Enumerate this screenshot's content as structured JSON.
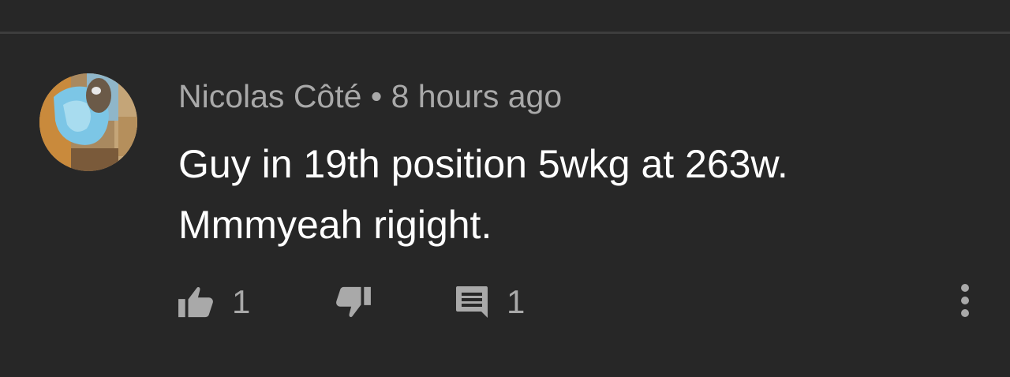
{
  "comment": {
    "author": "Nicolas Côté",
    "separator": "•",
    "timestamp": "8 hours ago",
    "lines": [
      "Guy in 19th position 5wkg at 263w.",
      "Mmmyeah rigight."
    ],
    "likes": "1",
    "replies": "1"
  },
  "colors": {
    "background": "#272727",
    "meta_text": "#a9a9a9",
    "body_text": "#ffffff",
    "icon": "#a9a9a9"
  },
  "icons": {
    "like": "thumbs-up-icon",
    "dislike": "thumbs-down-icon",
    "reply": "comment-icon",
    "more": "more-vertical-icon"
  }
}
